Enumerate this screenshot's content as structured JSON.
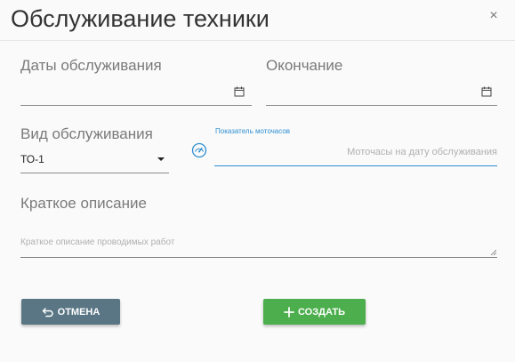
{
  "dialog": {
    "title": "Обслуживание техники",
    "close_glyph": "×"
  },
  "form": {
    "service_dates": {
      "label": "Даты обслуживания",
      "value": "",
      "icon": "calendar-icon"
    },
    "end_date": {
      "label": "Окончание",
      "value": "",
      "icon": "calendar-icon"
    },
    "service_type": {
      "label": "Вид обслуживания",
      "selected": "ТО-1",
      "icon": "dropdown-caret-icon"
    },
    "engine_hours": {
      "float_label": "Показатель моточасов",
      "placeholder": "Моточасы на дату обслуживания",
      "icon": "gauge-icon"
    },
    "description": {
      "label": "Краткое описание",
      "placeholder": "Краткое описание проводимых работ"
    }
  },
  "buttons": {
    "cancel": {
      "label": "ОТМЕНА",
      "icon": "undo-arrow-icon",
      "color": "#5a7684"
    },
    "create": {
      "label": "СОЗДАТЬ",
      "icon": "plus-icon",
      "color": "#4cae4c"
    }
  },
  "colors": {
    "accent": "#2e8fd1",
    "text": "#333333",
    "label": "#7a7a7a"
  }
}
